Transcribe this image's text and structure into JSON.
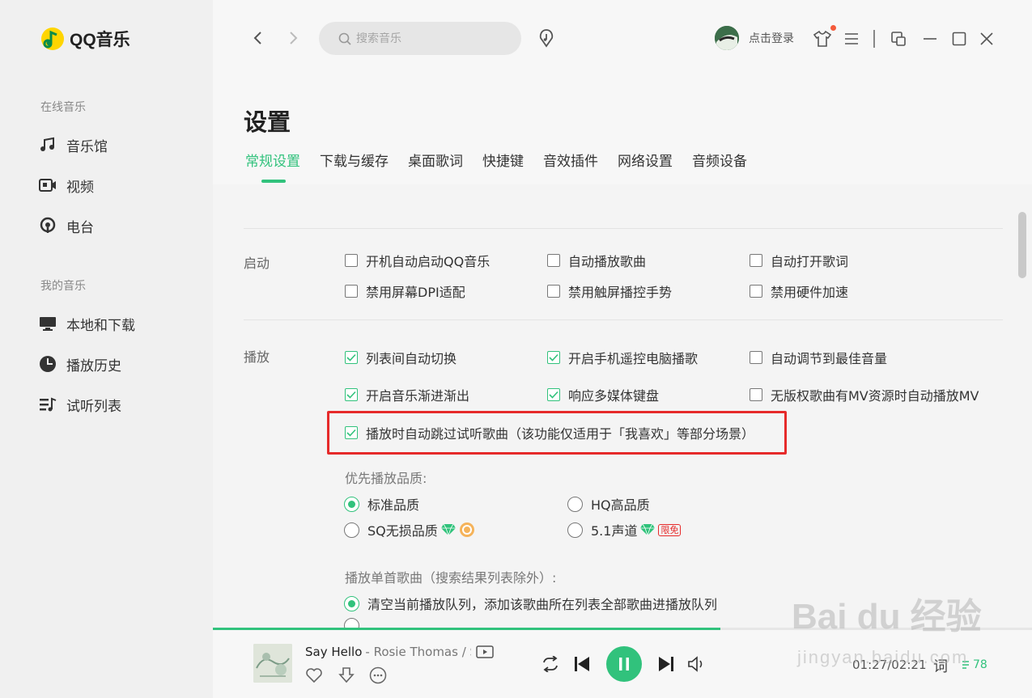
{
  "app": {
    "name": "QQ音乐",
    "brand_color": "#31c27c",
    "login_label": "点击登录",
    "search_placeholder": "搜索音乐"
  },
  "sidebar": {
    "online_section": "在线音乐",
    "online_items": [
      {
        "label": "音乐馆",
        "icon": "music-note-icon"
      },
      {
        "label": "视频",
        "icon": "video-icon"
      },
      {
        "label": "电台",
        "icon": "radio-icon"
      }
    ],
    "my_section": "我的音乐",
    "my_items": [
      {
        "label": "本地和下载",
        "icon": "monitor-icon"
      },
      {
        "label": "播放历史",
        "icon": "clock-icon"
      },
      {
        "label": "试听列表",
        "icon": "playlist-icon"
      }
    ]
  },
  "settings": {
    "title": "设置",
    "tabs": [
      "常规设置",
      "下载与缓存",
      "桌面歌词",
      "快捷键",
      "音效插件",
      "网络设置",
      "音频设备"
    ],
    "active_tab": "常规设置",
    "startup": {
      "label": "启动",
      "options": [
        {
          "label": "开机自动启动QQ音乐",
          "checked": false
        },
        {
          "label": "自动播放歌曲",
          "checked": false
        },
        {
          "label": "自动打开歌词",
          "checked": false
        },
        {
          "label": "禁用屏幕DPI适配",
          "checked": false
        },
        {
          "label": "禁用触屏播控手势",
          "checked": false
        },
        {
          "label": "禁用硬件加速",
          "checked": false
        }
      ]
    },
    "playback": {
      "label": "播放",
      "options": [
        {
          "label": "列表间自动切换",
          "checked": true
        },
        {
          "label": "开启手机遥控电脑播歌",
          "checked": true
        },
        {
          "label": "自动调节到最佳音量",
          "checked": false
        },
        {
          "label": "开启音乐渐进渐出",
          "checked": true
        },
        {
          "label": "响应多媒体键盘",
          "checked": true
        },
        {
          "label": "无版权歌曲有MV资源时自动播放MV",
          "checked": false
        },
        {
          "label": "播放时自动跳过试听歌曲（该功能仅适用于「我喜欢」等部分场景）",
          "checked": true
        }
      ],
      "quality_label": "优先播放品质:",
      "quality_options": [
        {
          "label": "标准品质",
          "selected": true
        },
        {
          "label": "HQ高品质",
          "selected": false
        },
        {
          "label": "SQ无损品质",
          "selected": false
        },
        {
          "label": "5.1声道",
          "selected": false
        }
      ],
      "limited_free_badge": "限免",
      "single_song_label": "播放单首歌曲（搜索结果列表除外）:",
      "single_song_options": [
        {
          "label": "清空当前播放队列，添加该歌曲所在列表全部歌曲进播放队列",
          "selected": true
        }
      ]
    }
  },
  "player": {
    "song_title": "Say Hello",
    "artist": "- Rosie Thomas / S",
    "time": "01:27/02:21",
    "lyric_label": "词",
    "count": "78",
    "progress": 0.62
  },
  "watermark": {
    "text": "Bai du 经验",
    "sub": "jingyan.baidu.com"
  }
}
